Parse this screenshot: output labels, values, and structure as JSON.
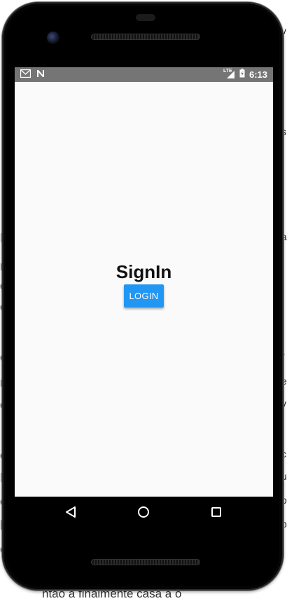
{
  "background_page": {
    "left_fragments": [
      "F",
      "r",
      "d",
      "o",
      "e",
      "n",
      "c",
      "o",
      "E",
      "o",
      "b",
      "o"
    ],
    "right_fragments": [
      "v",
      "s",
      "t",
      "a",
      "r",
      "e",
      "y",
      "c",
      "u",
      "o",
      "p"
    ],
    "bottom_fragment": "ntão a finalmente casa a o"
  },
  "statusbar": {
    "icons": [
      "gmail-icon",
      "n-notification-icon",
      "lte-signal-icon",
      "battery-charging-icon"
    ],
    "network_label": "LTE",
    "time": "6:13"
  },
  "app": {
    "title": "SignIn",
    "login_button": "LOGIN"
  },
  "navigation": {
    "buttons": [
      "back-icon",
      "home-icon",
      "recents-icon"
    ]
  },
  "colors": {
    "statusbar": "#757575",
    "screen_background": "#fafafa",
    "button": "#2196f3",
    "navbar": "#000000"
  }
}
